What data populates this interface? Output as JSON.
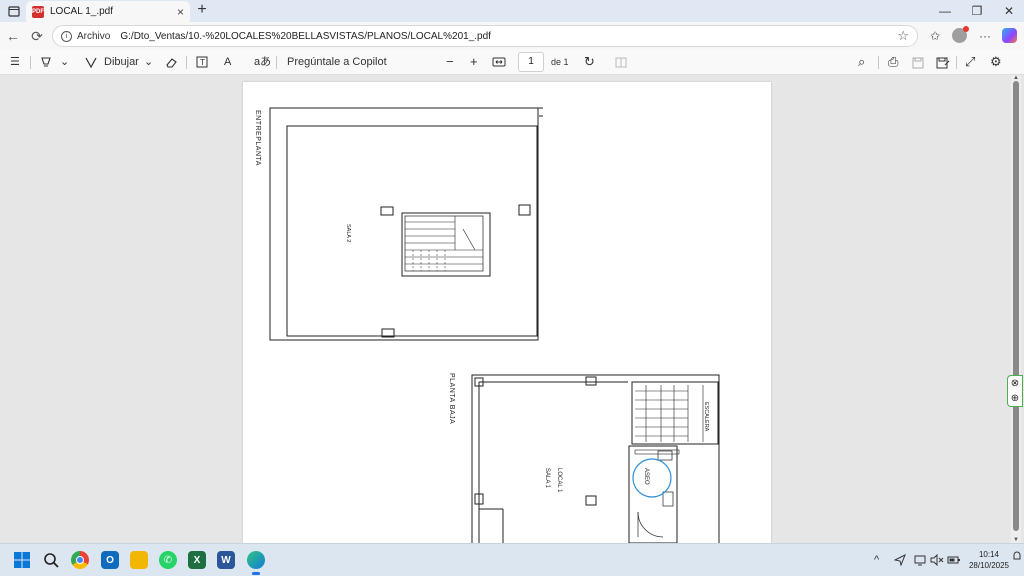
{
  "tab": {
    "title": "LOCAL 1_.pdf",
    "close": "×",
    "new": "+"
  },
  "window": {
    "minimize": "—",
    "restore": "❐",
    "close": "✕"
  },
  "nav": {
    "back": "←",
    "reload": "⟳",
    "scheme": "Archivo",
    "url": "G:/Dto_Ventas/10.-%20LOCALES%20BELLASVISTAS/PLANOS/LOCAL%201_.pdf",
    "favorite": "☆",
    "collections": "✩",
    "more": "···"
  },
  "pdf_toolbar": {
    "contents": "☰",
    "highlight_arrow": "⌄",
    "draw_label": "Dibujar",
    "draw_arrow": "⌄",
    "read_aloud": "A",
    "translate": "aあ",
    "copilot_label": "Pregúntale a Copilot",
    "zoom_out": "−",
    "zoom_in": "+",
    "page_current": "1",
    "page_total": "de 1",
    "rotate": "↻",
    "search": "⌕",
    "print": "⎙",
    "fullscreen": "⤢",
    "settings": "⚙"
  },
  "plan": {
    "upper_title": "ENTREPLANTA",
    "upper_room": "SALA 2",
    "lower_title": "PLANTA BAJA",
    "local_label": "LOCAL 1",
    "sala_label": "SALA 1",
    "aseo_label": "ASEO",
    "escalera_label": "ESCALERA"
  },
  "side_widget": {
    "top": "⊗",
    "bottom": "⊕"
  },
  "taskbar": {
    "clock_time": "10:14",
    "clock_date": "28/10/2025",
    "tray_chevron": "^"
  },
  "colors": {
    "accent": "#1a73e8",
    "aseo_circle": "#2b8fd6",
    "pdf_icon": "#d32f2f"
  }
}
